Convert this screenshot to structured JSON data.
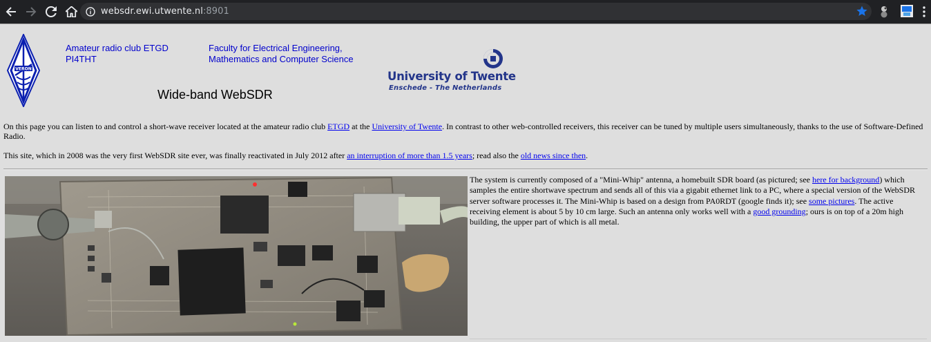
{
  "browser": {
    "url_host": "websdr.ewi.utwente.nl",
    "url_port": ":8901"
  },
  "header": {
    "club_line1": "Amateur radio club ETGD",
    "club_line2": "PI4THT",
    "faculty_line1": "Faculty for Electrical Engineering,",
    "faculty_line2": "Mathematics and Computer Science",
    "title": "Wide-band WebSDR",
    "university_name": "University of Twente",
    "university_location": "Enschede - The Netherlands",
    "veron_logo_text": "VERON"
  },
  "intro": {
    "p1_text1": "On this page you can listen to and control a short-wave receiver located at the amateur radio club ",
    "p1_link1": "ETGD",
    "p1_text2": " at the ",
    "p1_link2": "University of Twente",
    "p1_text3": ". In contrast to other web-controlled receivers, this receiver can be tuned by multiple users simultaneously, thanks to the use of Software-Defined Radio.",
    "p2_text1": "This site, which in 2008 was the very first WebSDR site ever, was finally reactivated in July 2012 after ",
    "p2_link1": "an interruption of more than 1.5 years",
    "p2_text2": "; read also the ",
    "p2_link2": "old news since then",
    "p2_text3": "."
  },
  "system": {
    "t1": "The system is currently composed of a \"Mini-Whip\" antenna, a homebuilt SDR board (as pictured; see ",
    "link1": "here for background",
    "t2": ") which samples the entire shortwave spectrum and sends all of this via a gigabit ethernet link to a PC, where a special version of the WebSDR server software processes it. The Mini-Whip is based on a design from PA0RDT (google finds it); see ",
    "link2": "some pictures",
    "t3": ". The active receiving element is about 5 by 10 cm large. Such an antenna only works well with a ",
    "link3": "good grounding",
    "t4": "; ours is on top of a 20m high building, the upper part of which is all metal."
  },
  "colors": {
    "link": "#0000ee",
    "header_link": "#0000cc",
    "ut_blue": "#23358a",
    "chrome_bg": "#202124",
    "star": "#1a73e8"
  },
  "icons": [
    "back-arrow-icon",
    "forward-arrow-icon",
    "reload-icon",
    "home-icon",
    "info-icon",
    "star-icon",
    "extension-icon",
    "menu-icon"
  ]
}
